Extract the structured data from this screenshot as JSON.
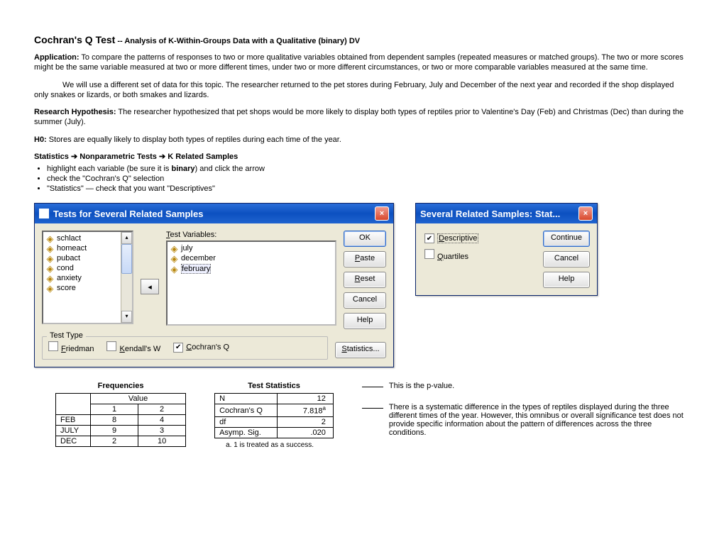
{
  "title": "Cochran's Q Test",
  "subtitle": "-- Analysis of K-Within-Groups Data with a Qualitative (binary) DV",
  "application_label": "Application:",
  "application_text": "To compare the patterns of responses to two or more qualitative variables obtained from dependent samples (repeated measures or matched groups).  The two or more scores might be the same variable measured at two or more different times, under two or more different circumstances, or two or more comparable variables measured at the same time.",
  "intro_text": "We will use a different set of data for this topic.  The researcher returned to the pet stores during February, July and December of the next year and recorded if the shop displayed only snakes or lizards, or both smakes and lizards.",
  "rh_label": "Research Hypothesis:",
  "rh_text": "The researcher hypothesized that pet shops would be more likely to display both types of reptiles prior to Valentine's Day (Feb) and  Christmas (Dec) than during the summer (July).",
  "h0_label": "H0:",
  "h0_text": "Stores are equally likely to display both types of reptiles during each time of the year.",
  "menu_path": {
    "a": "Statistics",
    "b": "Nonparametric Tests",
    "c": "K Related Samples"
  },
  "bullets": [
    {
      "pre": "highlight each variable (be sure it is ",
      "bold": "binary",
      "post": ") and click the arrow"
    },
    {
      "pre": "check the \"Cochran's Q\" selection",
      "bold": "",
      "post": ""
    },
    {
      "pre": "\"Statistics\" — check that you want \"Descriptives\"",
      "bold": "",
      "post": ""
    }
  ],
  "dlg_main": {
    "title": "Tests for Several Related Samples",
    "source_vars": [
      "schlact",
      "homeact",
      "pubact",
      "cond",
      "anxiety",
      "score"
    ],
    "test_label": "Test Variables:",
    "test_vars": [
      "july",
      "december",
      "february"
    ],
    "buttons": {
      "ok": "OK",
      "paste": "Paste",
      "reset": "Reset",
      "cancel": "Cancel",
      "help": "Help",
      "stats": "Statistics..."
    },
    "testtype_legend": "Test Type",
    "opts": {
      "friedman": "Friedman",
      "kendall": "Kendall's W",
      "cochran": "Cochran's Q"
    }
  },
  "dlg_stat": {
    "title": "Several Related Samples: Stat...",
    "descriptive": "Descriptive",
    "descriptive_u": "D",
    "quartiles": "Quartiles",
    "quartiles_u": "Q",
    "continue": "Continue",
    "cancel": "Cancel",
    "help": "Help"
  },
  "freq": {
    "title": "Frequencies",
    "colhead": "Value",
    "c1": "1",
    "c2": "2",
    "rows": [
      {
        "label": "FEB",
        "v1": "8",
        "v2": "4"
      },
      {
        "label": "JULY",
        "v1": "9",
        "v2": "3"
      },
      {
        "label": "DEC",
        "v1": "2",
        "v2": "10"
      }
    ]
  },
  "stats": {
    "title": "Test Statistics",
    "rows": [
      {
        "label": "N",
        "val": "12",
        "sup": ""
      },
      {
        "label": "Cochran's Q",
        "val": "7.818",
        "sup": "a"
      },
      {
        "label": "df",
        "val": "2",
        "sup": ""
      },
      {
        "label": "Asymp. Sig.",
        "val": ".020",
        "sup": ""
      }
    ],
    "footnote_a": "a.",
    "footnote": "1 is treated as a success."
  },
  "annot1": "This is the p-value.",
  "annot2": "There is a systematic difference in the types of reptiles displayed during the three different times of the year.  However, this omnibus or overall significance test does not provide specific information about the pattern of differences across the three conditions."
}
